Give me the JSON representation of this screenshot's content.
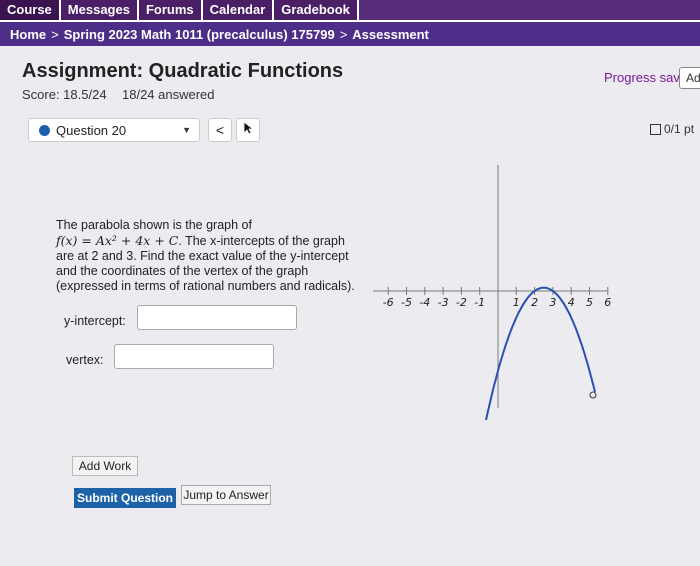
{
  "nav": [
    "Course",
    "Messages",
    "Forums",
    "Calendar",
    "Gradebook"
  ],
  "breadcrumb": {
    "home": "Home",
    "course": "Spring 2023 Math 1011 (precalculus) 175799",
    "current": "Assessment"
  },
  "assignment": {
    "title": "Assignment: Quadratic Functions",
    "score": "Score: 18.5/24",
    "answered": "18/24 answered",
    "progress": "Progress saved",
    "ad_label": "Ad"
  },
  "question_nav": {
    "selected": "Question 20",
    "prev": "<",
    "points": "0/1 pt"
  },
  "question": {
    "line1": "The parabola shown is the graph of",
    "formula": "f(x) = Ax² + 4x + C",
    "line2": "The x-intercepts of the graph are at",
    "intercept1": "2",
    "and": "and",
    "intercept2": "3",
    "line3": "Find the exact value of the y-intercept and the coordinates of the vertex of the graph (expressed in terms of rational numbers and radicals)."
  },
  "fields": {
    "y_intercept_label": "y-intercept:",
    "vertex_label": "vertex:"
  },
  "buttons": {
    "add_work": "Add Work",
    "submit": "Submit Question",
    "jump": "Jump to Answer"
  },
  "graph": {
    "x_ticks": [
      "-6",
      "-5",
      "-4",
      "-3",
      "-2",
      "-1",
      "1",
      "2",
      "3",
      "4",
      "5",
      "6"
    ]
  },
  "colors": {
    "nav_bg": "#5a2d7a",
    "breadcrumb_bg": "#4d2f8a",
    "progress_text": "#7a1a9a",
    "submit_bg": "#1d62a6",
    "curve": "#2b4fb5"
  }
}
